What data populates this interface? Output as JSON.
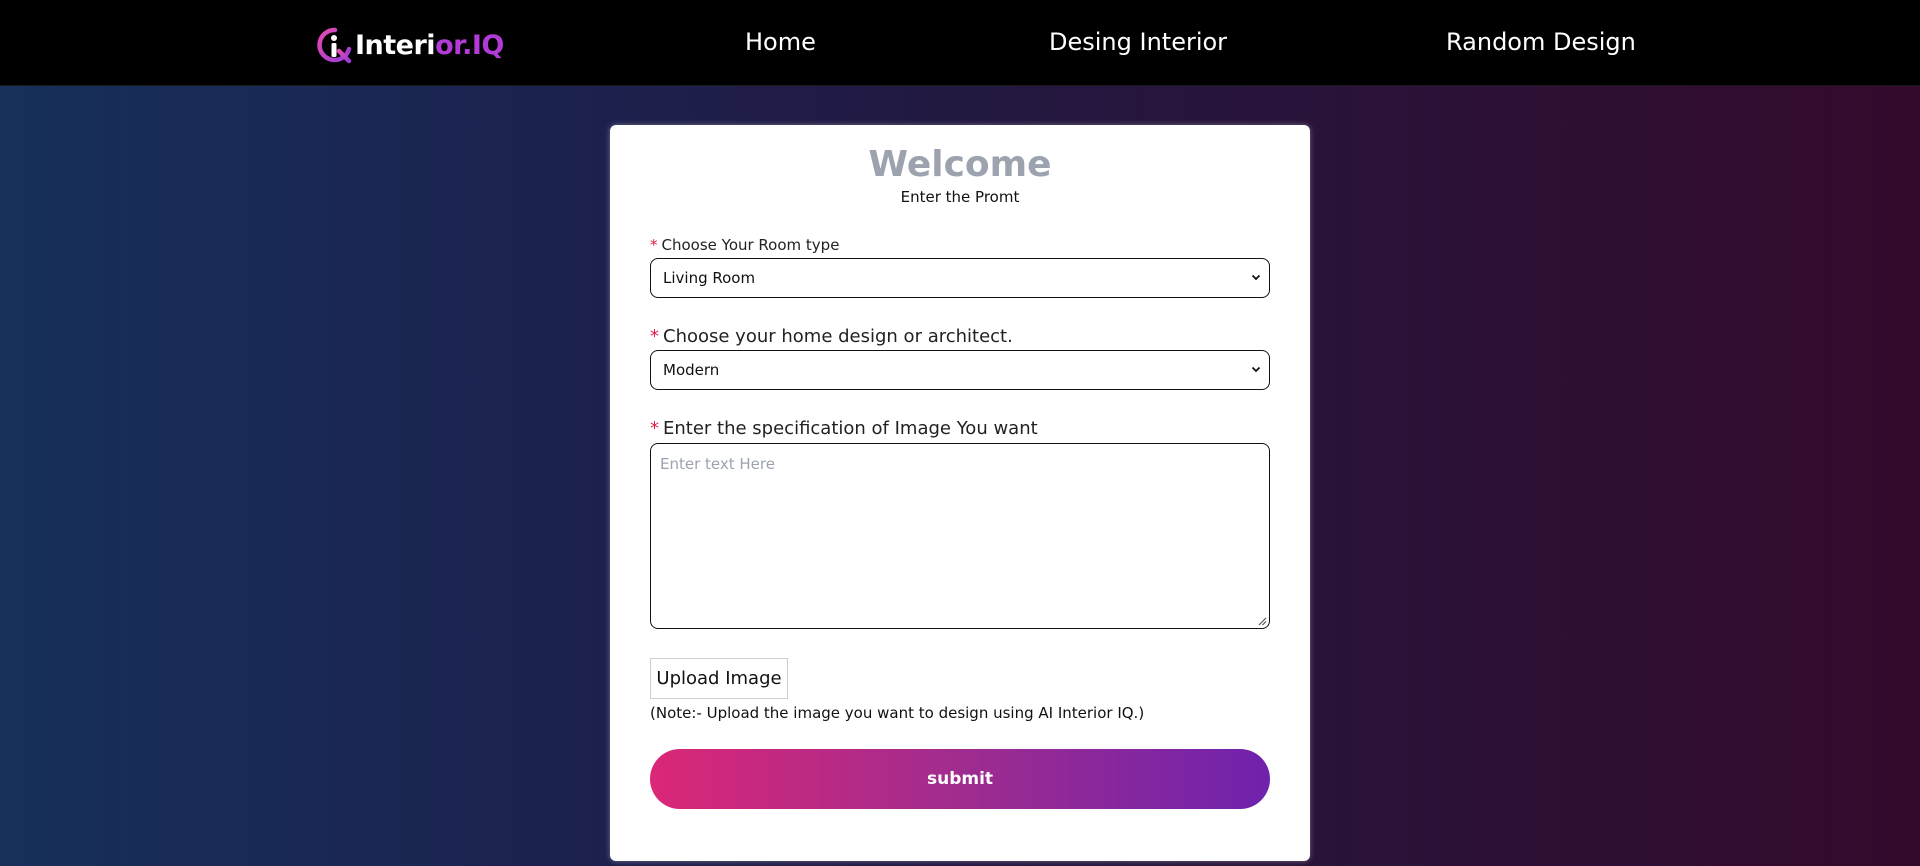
{
  "navbar": {
    "logo": {
      "text_white": "Interi",
      "text_purple": "or.IQ",
      "icon": "interior-iq-logo-icon"
    },
    "links": [
      {
        "label": "Home"
      },
      {
        "label": "Desing Interior"
      },
      {
        "label": "Random Design"
      }
    ]
  },
  "form": {
    "title": "Welcome",
    "subtitle": "Enter the Promt",
    "required_marker": "*",
    "room_type": {
      "label": "Choose Your Room type",
      "value": "Living Room"
    },
    "design": {
      "label": "Choose your home design or architect.",
      "value": "Modern"
    },
    "specification": {
      "label": "Enter the specification of Image You want",
      "placeholder": "Enter text Here"
    },
    "upload": {
      "label": "Upload Image",
      "note": "(Note:- Upload the image you want to design using AI Interior IQ.)"
    },
    "submit_label": "submit"
  },
  "colors": {
    "accent_pink": "#db2777",
    "accent_purple": "#6f22ad",
    "title_gray": "#9ca3af",
    "required_red": "#e11d48"
  }
}
